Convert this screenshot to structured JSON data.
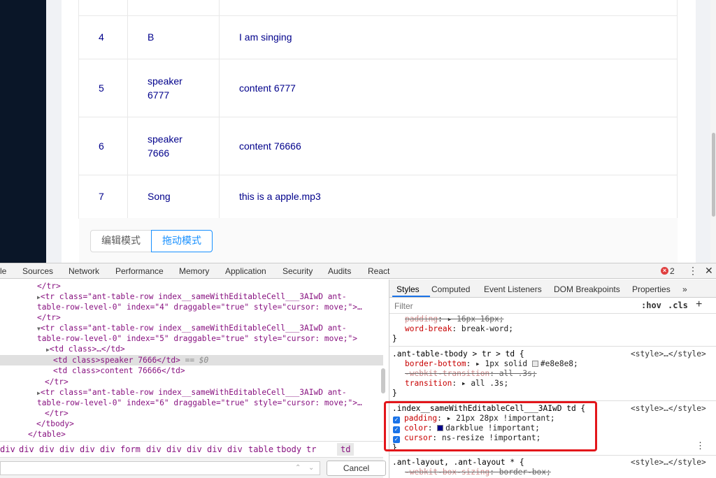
{
  "table": {
    "rows": [
      {
        "index": "",
        "speaker": "",
        "content": ""
      },
      {
        "index": "4",
        "speaker": "B",
        "content": "I am singing"
      },
      {
        "index": "5",
        "speaker": "speaker 6777",
        "content": "content 6777"
      },
      {
        "index": "6",
        "speaker": "speaker 7666",
        "content": "content 76666"
      },
      {
        "index": "7",
        "speaker": "Song",
        "content": "this is a apple.mp3"
      }
    ]
  },
  "modes": {
    "edit_label": "编辑模式",
    "drag_label": "拖动模式"
  },
  "devtools": {
    "tabs": [
      "le",
      "Sources",
      "Network",
      "Performance",
      "Memory",
      "Application",
      "Security",
      "Audits",
      "React"
    ],
    "error_count": "2",
    "error_icon_glyph": "×",
    "kebab": "⋮",
    "close": "✕",
    "elements": {
      "l1_close_tr": "</tr>",
      "tr4_a": "<tr class=\"ant-table-row index__sameWithEditableCell___3AIwD ant-",
      "tr4_b": "table-row-level-0\" index=\"4\" draggable=\"true\" style=\"cursor: move;\">…",
      "l4_close_tr": "</tr>",
      "tr5_a": "<tr class=\"ant-table-row index__sameWithEditableCell___3AIwD ant-",
      "tr5_b": "table-row-level-0\" index=\"5\" draggable=\"true\" style=\"cursor: move;\">",
      "td_collapsed": "<td class>…</td>",
      "td_speaker": "<td class>speaker 7666</td>",
      "td_speaker_suffix": " == $0",
      "td_content": "<td class>content 76666</td>",
      "l10_close_tr": "</tr>",
      "tr6_a": "<tr class=\"ant-table-row index__sameWithEditableCell___3AIwD ant-",
      "tr6_b": "table-row-level-0\" index=\"6\" draggable=\"true\" style=\"cursor: move;\">…",
      "l13_close_tr": "</tr>",
      "close_tbody": "</tbody>",
      "close_table": "</table>"
    },
    "breadcrumbs": [
      "div",
      "div",
      "div",
      "div",
      "div",
      "div",
      "form",
      "div",
      "div",
      "div",
      "div",
      "div",
      "table",
      "tbody",
      "tr",
      "td"
    ],
    "cancel_label": "Cancel",
    "arrow_up": "⌃",
    "arrow_down": "⌄",
    "styles": {
      "tabs": [
        "Styles",
        "Computed",
        "Event Listeners",
        "DOM Breakpoints",
        "Properties",
        "»"
      ],
      "filter_placeholder": "Filter",
      "hov": ":hov",
      "cls": ".cls",
      "plus": "+",
      "rule0_padding_prop": "padding",
      "rule0_padding_val": "16px 16px;",
      "rule0_wb_prop": "word-break",
      "rule0_wb_val": "break-word;",
      "rule0_close": "}",
      "rule1_selector": ".ant-table-tbody > tr > td {",
      "rule1_source": "<style>…</style>",
      "rule1_bb_prop": "border-bottom",
      "rule1_bb_val": "1px solid",
      "rule1_bb_color": "#e8e8e8;",
      "rule1_wt_prop": "-webkit-transition",
      "rule1_wt_val": "all .3s;",
      "rule1_t_prop": "transition",
      "rule1_t_val": "all .3s;",
      "rule1_close": "}",
      "rule2_selector": ".index__sameWithEditableCell___3AIwD td {",
      "rule2_source": "<style>…</style>",
      "rule2_padding_prop": "padding",
      "rule2_padding_val": "21px 28px !important;",
      "rule2_color_prop": "color",
      "rule2_color_val": "darkblue !important;",
      "rule2_cursor_prop": "cursor",
      "rule2_cursor_val": "ns-resize !important;",
      "rule2_close": "}",
      "rule3_selector": ".ant-layout, .ant-layout * {",
      "rule3_source": "<style>…</style>",
      "rule3_prop": "-webkit-box-sizing",
      "rule3_val": "border-box;",
      "more": "⋮"
    }
  },
  "colors": {
    "darkblue": "#00008b",
    "accent": "#1890ff",
    "highlight": "#e3161b",
    "border_swatch": "#e8e8e8"
  }
}
